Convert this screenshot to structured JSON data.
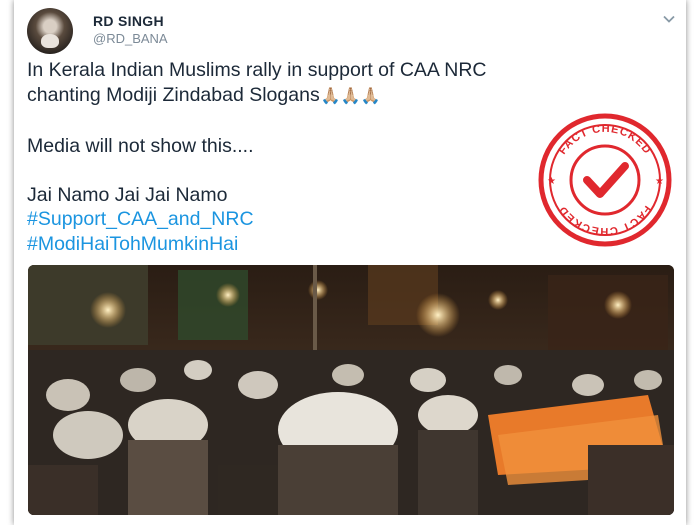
{
  "tweet": {
    "author_name": "RD SINGH",
    "author_handle": "@RD_BANA",
    "lines": [
      "In Kerala Indian Muslims rally in support of CAA NRC",
      "chanting Modiji Zindabad Slogans",
      "Media will not show this....",
      "Jai Namo Jai Jai Namo"
    ],
    "emojis": "🙏🏼🙏🏼🙏🏼",
    "hashtags": [
      "#Support_CAA_and_NRC",
      "#ModiHaiTohMumkinHai"
    ]
  },
  "stamp": {
    "top_text": "FACT CHECKED",
    "bottom_text": "FACT CHECKED",
    "color": "#e0282e"
  },
  "colors": {
    "text": "#1c2938",
    "handle": "#7c8a97",
    "hashtag": "#1b95e0"
  },
  "icons": {
    "menu": "chevron-down-icon",
    "stamp_mark": "check-icon"
  }
}
